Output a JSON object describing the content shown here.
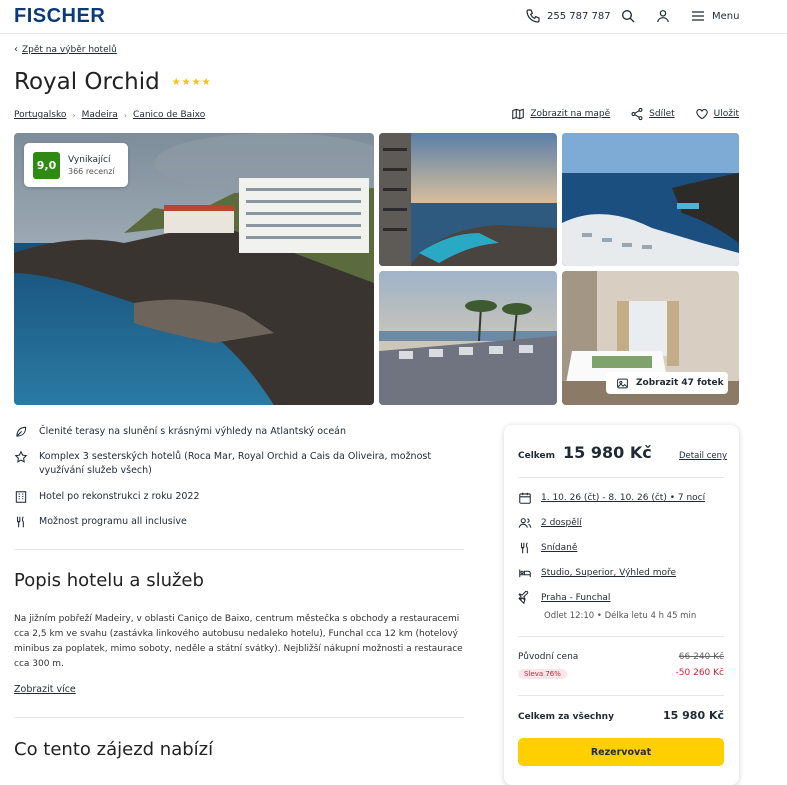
{
  "header": {
    "logo": "FISCHER",
    "phone": "255 787 787",
    "menu_label": "Menu"
  },
  "nav": {
    "back_label": "Zpět na výběr hotelů"
  },
  "hotel": {
    "name": "Royal Orchid",
    "stars": "★★★★",
    "breadcrumbs": [
      "Portugalsko",
      "Madeira",
      "Canico de Baixo"
    ]
  },
  "actions": {
    "map": "Zobrazit na mapě",
    "share": "Sdílet",
    "save": "Uložit"
  },
  "rating": {
    "score": "9,0",
    "label": "Vynikající",
    "reviews": "366 recenzí"
  },
  "gallery": {
    "show_photos": "Zobrazit 47 fotek"
  },
  "features": [
    "Členité terasy na slunění s krásnými výhledy na Atlantský oceán",
    "Komplex 3 sesterských hotelů (Roca Mar, Royal Orchid a Cais da Oliveira, možnost využívání služeb všech)",
    "Hotel po rekonstrukci z roku 2022",
    "Možnost programu all inclusive"
  ],
  "description": {
    "heading": "Popis hotelu a služeb",
    "text": "Na jižním pobřeží Madeiry, v oblasti Caniço de Baixo, centrum městečka s obchody a restauracemi cca 2,5 km ve svahu (zastávka linkového autobusu nedaleko hotelu), Funchal cca 12 km (hotelový minibus za poplatek, mimo soboty, neděle a státní svátky). Nejbližší nákupní možnosti a restaurace cca 300 m.",
    "more": "Zobrazit více"
  },
  "offer": {
    "heading": "Co tento zájezd nabízí"
  },
  "booking": {
    "total_label": "Celkem",
    "total_price": "15 980 Kč",
    "price_detail": "Detail ceny",
    "dates": "1. 10. 26 (čt) - 8. 10. 26 (čt) • 7 nocí",
    "persons": "2 dospělí",
    "board": "Snídaně",
    "room": "Studio, Superior, Výhled moře",
    "flight": "Praha - Funchal",
    "flight_info": "Odlet 12:10 • Délka letu 4 h 45 min",
    "original_label": "Původní cena",
    "original_price": "66 240 Kč",
    "discount_badge": "Sleva 76%",
    "discount": "-50 260 Kč",
    "total_all_label": "Celkem za všechny",
    "total_all": "15 980 Kč",
    "reserve": "Rezervovat"
  },
  "colors": {
    "brand": "#0b3a7a",
    "accent": "#ffcf00",
    "score": "#2e8a12",
    "discount": "#d0213a"
  }
}
